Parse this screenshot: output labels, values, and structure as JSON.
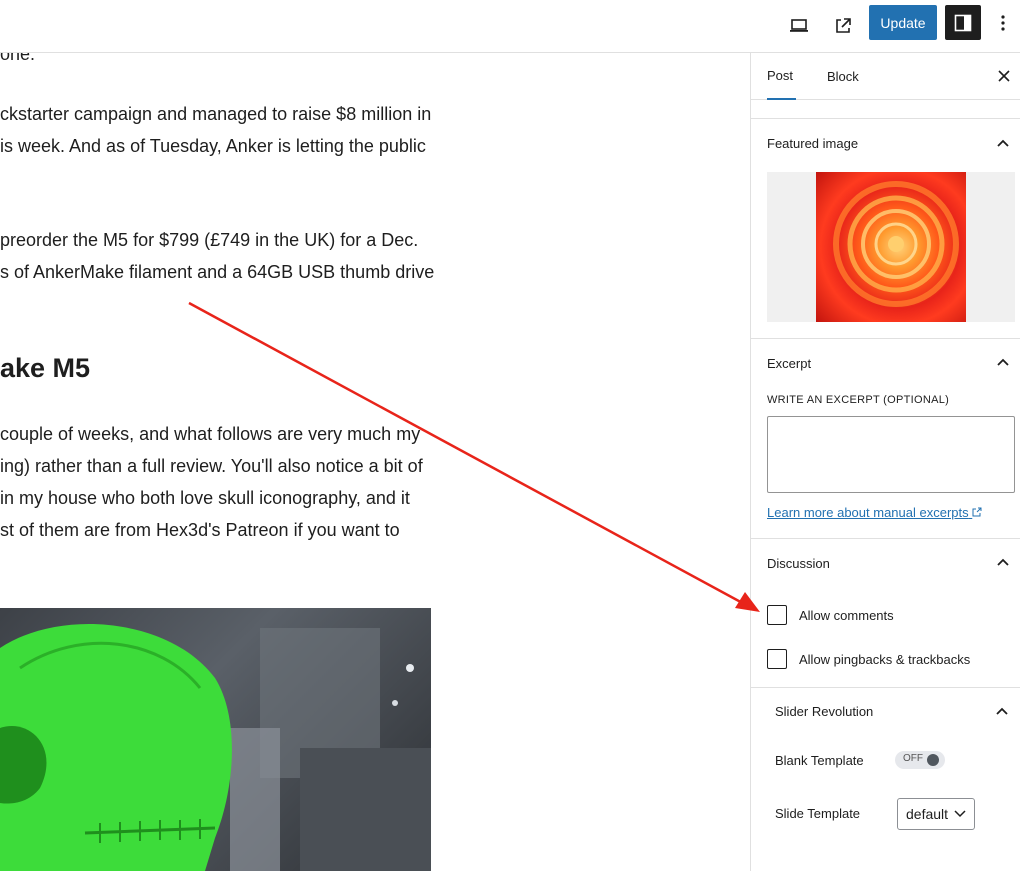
{
  "toolbar": {
    "update_label": "Update"
  },
  "content": {
    "lines": [
      "one.",
      "ckstarter campaign and managed to raise $8 million in",
      "is week. And as of Tuesday, Anker is letting the public",
      " preorder the M5 for $799 (£749 in the UK) for a Dec.",
      "s of AnkerMake filament and a 64GB USB thumb drive",
      "couple of weeks, and what follows are very much my",
      "ing) rather than a full review. You'll also notice a bit of",
      " in my house who both love skull iconography, and it",
      "st of them are from Hex3d's Patreon if you want to"
    ],
    "heading": "ake M5"
  },
  "sidebar": {
    "tabs": [
      "Post",
      "Block"
    ],
    "featured_image": {
      "title": "Featured image"
    },
    "excerpt": {
      "title": "Excerpt",
      "label": "WRITE AN EXCERPT (OPTIONAL)",
      "value": "",
      "link": "Learn more about manual excerpts"
    },
    "discussion": {
      "title": "Discussion",
      "allow_comments": "Allow comments",
      "allow_pingbacks": "Allow pingbacks & trackbacks"
    },
    "slider_revolution": {
      "title": "Slider Revolution",
      "blank_template_label": "Blank Template",
      "blank_template_state": "OFF",
      "slide_template_label": "Slide Template",
      "slide_template_value": "default"
    }
  },
  "colors": {
    "accent": "#2271b1",
    "arrow": "#e8241a"
  }
}
